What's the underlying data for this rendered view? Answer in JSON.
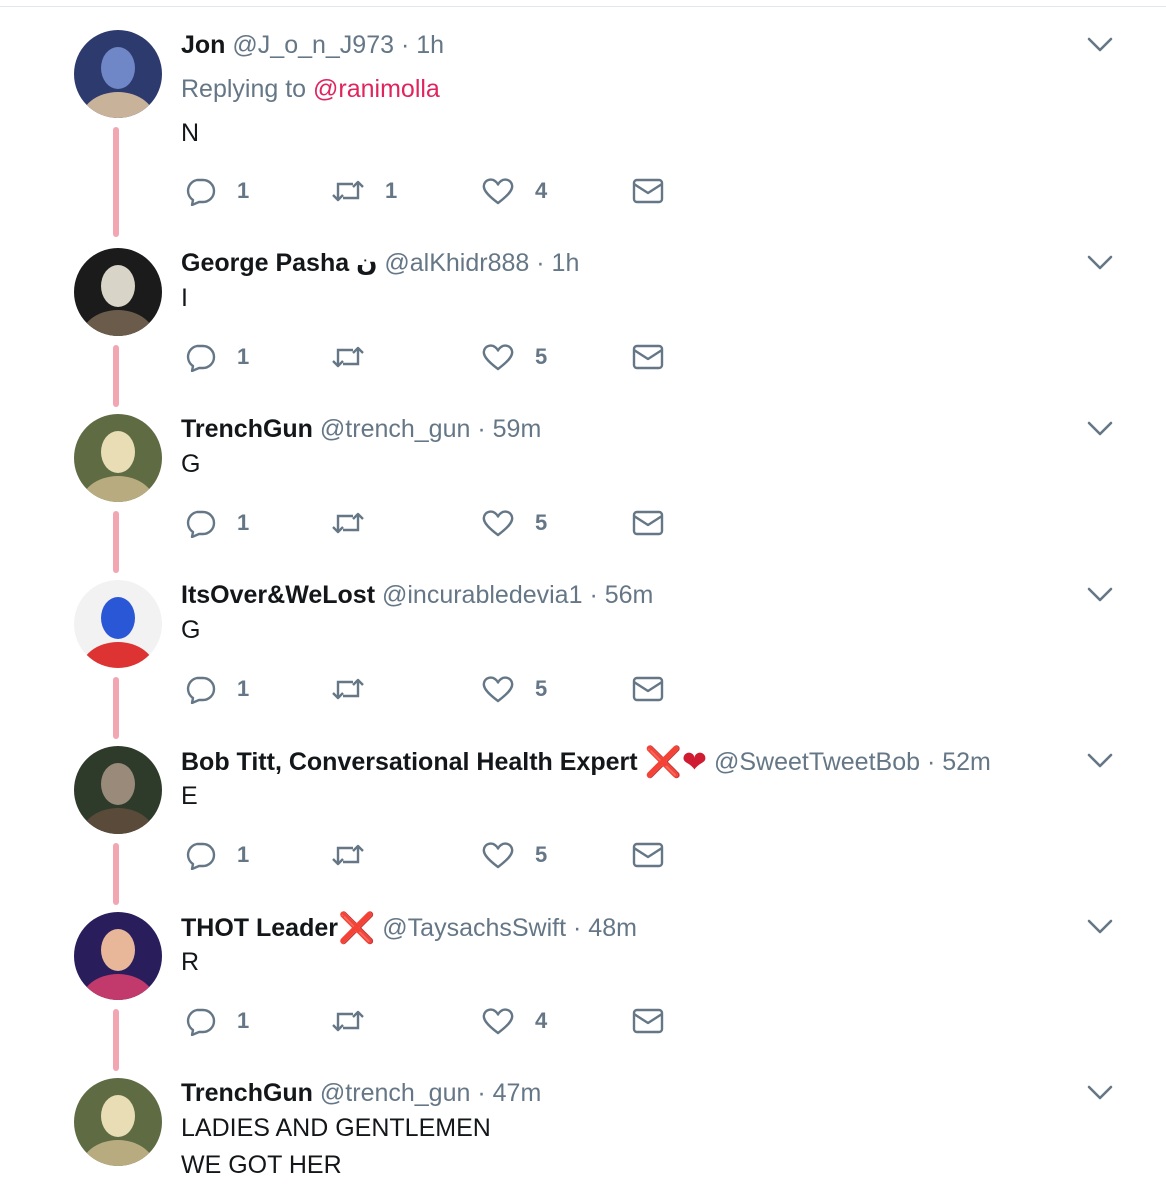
{
  "tweets": [
    {
      "name": "Jon",
      "handle": "@J_o_n_J973",
      "time": "1h",
      "replying_prefix": "Replying to",
      "replying_to": "@ranimolla",
      "lines": [
        "N"
      ],
      "replies": "1",
      "retweets": "1",
      "likes": "4",
      "avatar_colors": [
        "#2d3a6e",
        "#6f86c7",
        "#c9b29a"
      ]
    },
    {
      "name": "George Pasha",
      "name_glyph": "ن",
      "handle": "@alKhidr888",
      "time": "1h",
      "lines": [
        "I"
      ],
      "replies": "1",
      "retweets": "",
      "likes": "5",
      "avatar_colors": [
        "#1b1b1b",
        "#d9d4c8",
        "#6b5b4a"
      ]
    },
    {
      "name": "TrenchGun",
      "handle": "@trench_gun",
      "time": "59m",
      "lines": [
        "G"
      ],
      "replies": "1",
      "retweets": "",
      "likes": "5",
      "avatar_colors": [
        "#5e6b43",
        "#e8ddb5",
        "#b9ab80"
      ]
    },
    {
      "name": "ItsOver&WeLost",
      "handle": "@incurabledevia1",
      "time": "56m",
      "lines": [
        "G"
      ],
      "replies": "1",
      "retweets": "",
      "likes": "5",
      "avatar_colors": [
        "#f2f2f2",
        "#2a57d6",
        "#d33"
      ]
    },
    {
      "name": "Bob Titt, Conversational Health Expert",
      "badges": {
        "cross": "❌",
        "heart": "❤"
      },
      "handle": "@SweetTweetBob",
      "time": "52m",
      "lines": [
        "E"
      ],
      "replies": "1",
      "retweets": "",
      "likes": "5",
      "avatar_colors": [
        "#2f3b2a",
        "#9a8a7a",
        "#5a4a3a"
      ]
    },
    {
      "name": "THOT Leader",
      "badges": {
        "cross": "❌"
      },
      "handle": "@TaysachsSwift",
      "time": "48m",
      "lines": [
        "R"
      ],
      "replies": "1",
      "retweets": "",
      "likes": "4",
      "avatar_colors": [
        "#2a1d5c",
        "#e8b79a",
        "#c23a6b"
      ]
    },
    {
      "name": "TrenchGun",
      "handle": "@trench_gun",
      "time": "47m",
      "lines": [
        "LADIES AND GENTLEMEN",
        "WE GOT HER"
      ],
      "avatar_colors": [
        "#5e6b43",
        "#e8ddb5",
        "#b9ab80"
      ]
    }
  ],
  "separator": "·",
  "icons": [
    "reply-icon",
    "retweet-icon",
    "like-icon",
    "dm-icon",
    "chevron-down-icon"
  ],
  "colors": {
    "thread_line": "#f2a6b2",
    "mention": "#e0245e",
    "meta": "#657786"
  }
}
